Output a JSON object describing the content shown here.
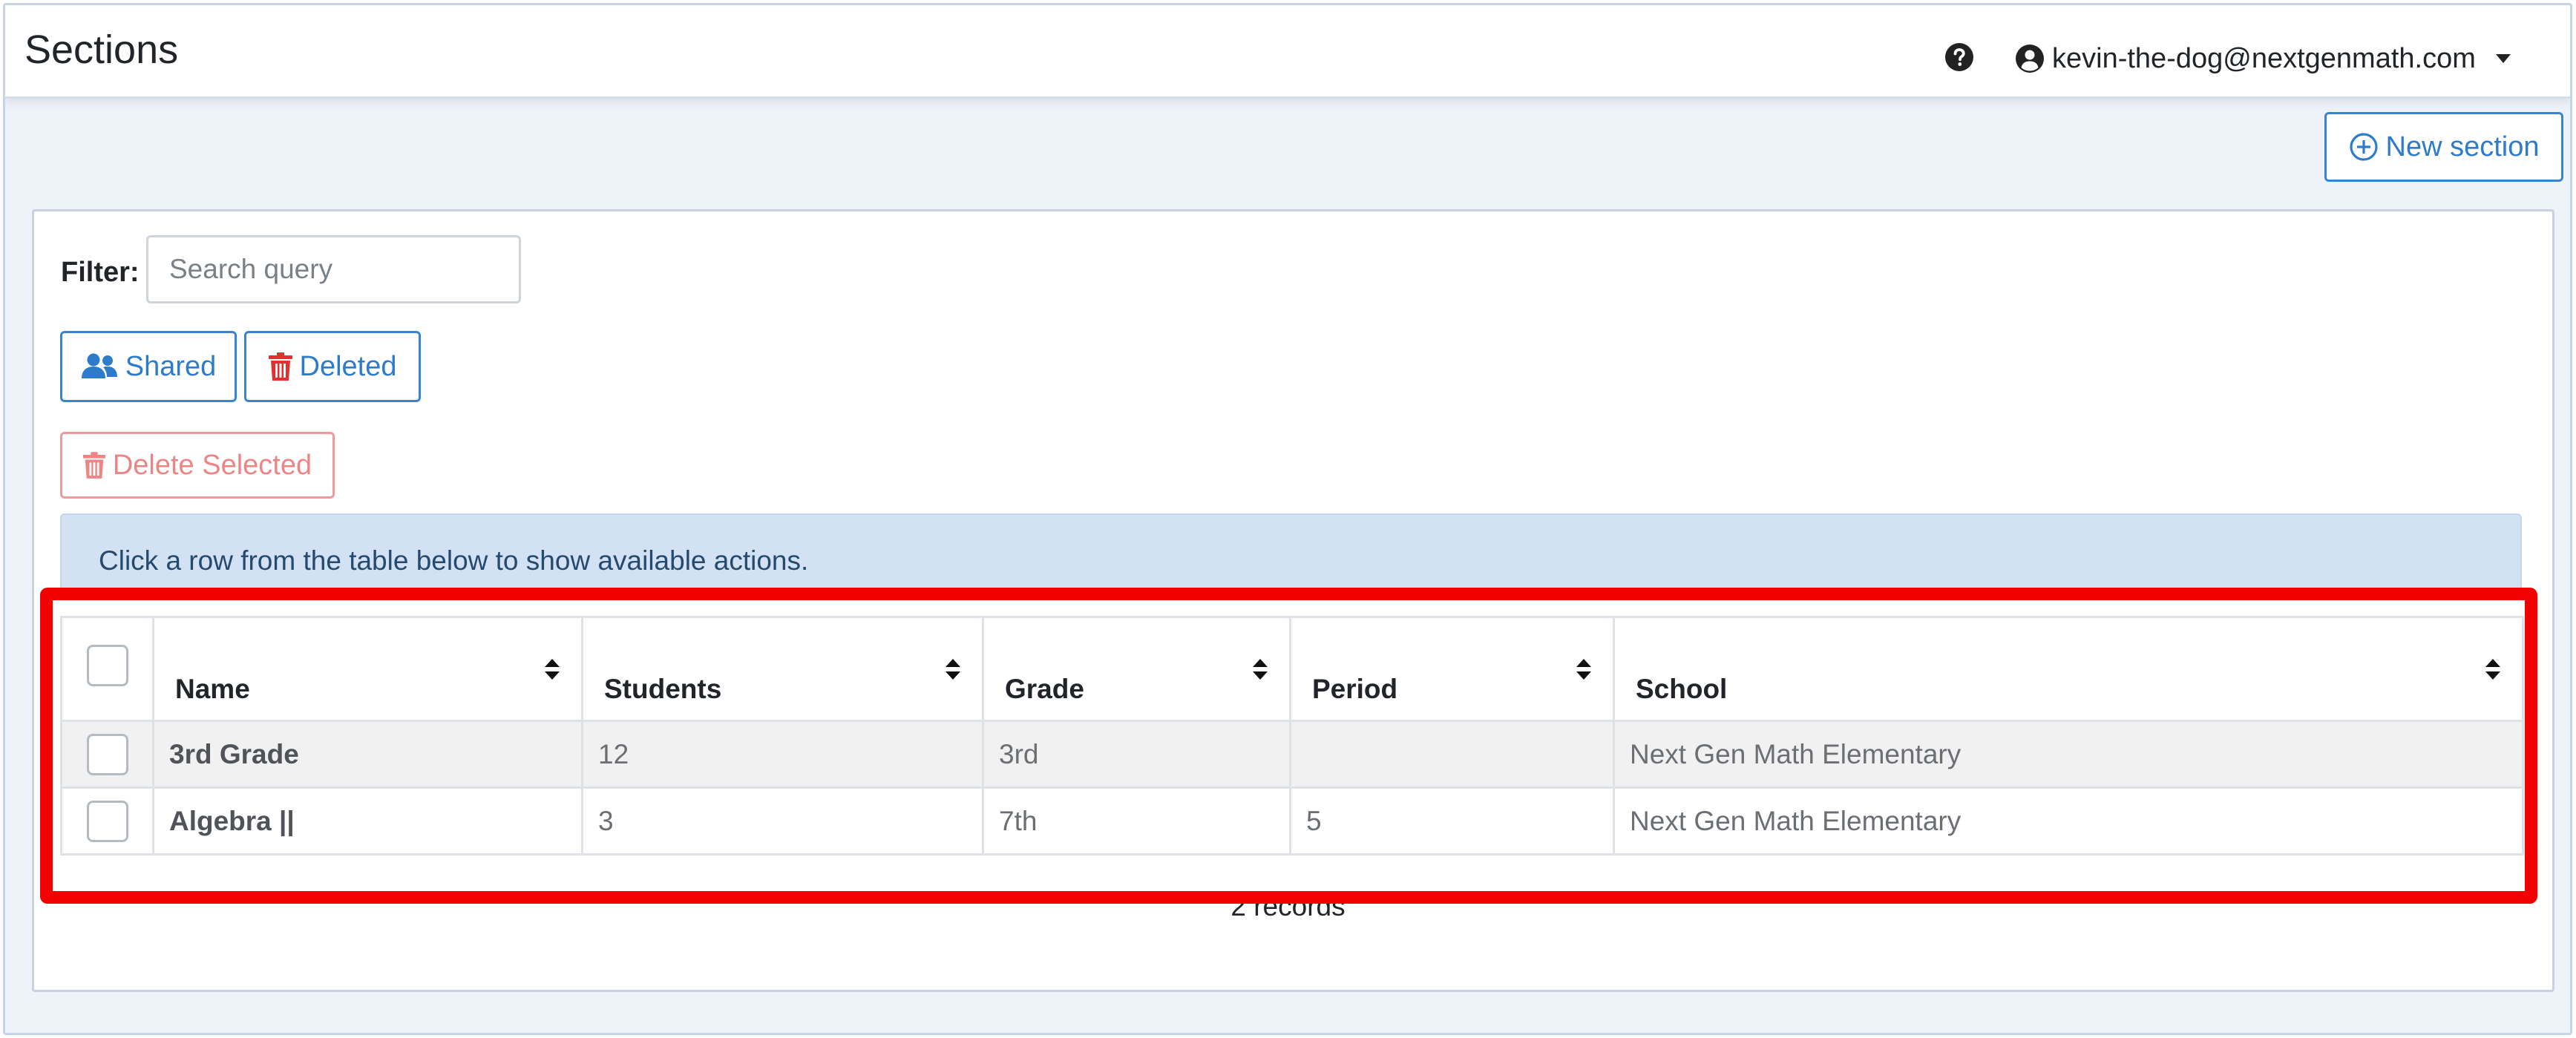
{
  "header": {
    "title": "Sections",
    "user_email": "kevin-the-dog@nextgenmath.com"
  },
  "toolbar": {
    "new_section_label": "New section"
  },
  "filter": {
    "label": "Filter:",
    "placeholder": "Search query",
    "value": ""
  },
  "toggles": {
    "shared_label": "Shared",
    "deleted_label": "Deleted"
  },
  "actions": {
    "delete_selected_label": "Delete Selected"
  },
  "info_message": "Click a row from the table below to show available actions.",
  "table": {
    "columns": [
      "Name",
      "Students",
      "Grade",
      "Period",
      "School"
    ],
    "rows": [
      {
        "name": "3rd Grade",
        "students": "12",
        "grade": "3rd",
        "period": "",
        "school": "Next Gen Math Elementary"
      },
      {
        "name": "Algebra ||",
        "students": "3",
        "grade": "7th",
        "period": "5",
        "school": "Next Gen Math Elementary"
      }
    ],
    "records_text": "2 records"
  },
  "colors": {
    "primary": "#2d7ccc",
    "danger_light": "#ee8585",
    "info_bg": "#d2e2f4",
    "page_bg": "#eef2f9",
    "highlight": "#f00000"
  },
  "icons": {
    "help": "question-circle-icon",
    "user": "user-circle-icon",
    "caret": "caret-down-icon",
    "new": "plus-circle-icon",
    "shared": "users-icon",
    "deleted": "trash-icon",
    "sort": "sort-icon"
  }
}
